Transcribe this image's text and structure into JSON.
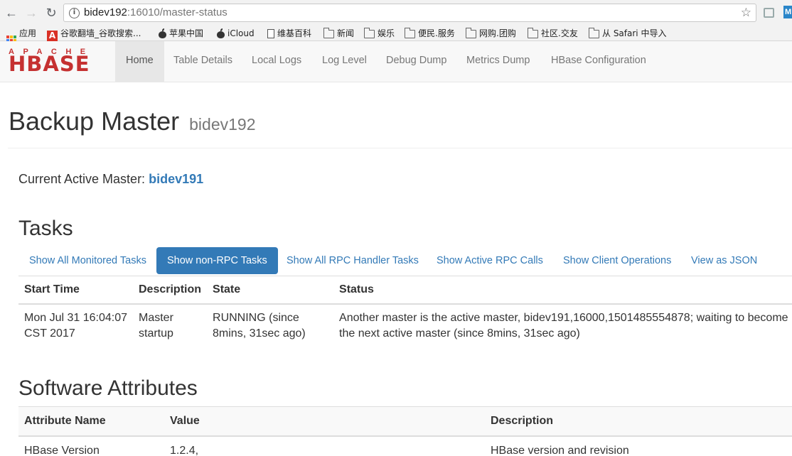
{
  "browser": {
    "url_host": "bidev192",
    "url_rest": ":16010/master-status",
    "bookmarks": [
      {
        "label": "应用",
        "icon": "apps-icon"
      },
      {
        "label": "谷歌翻墙_谷歌搜索...",
        "icon": "red-a-icon"
      },
      {
        "label": "苹果中国",
        "icon": "apple-icon"
      },
      {
        "label": "iCloud",
        "icon": "apple-icon"
      },
      {
        "label": "维基百科",
        "icon": "page-icon"
      },
      {
        "label": "新闻",
        "icon": "folder-icon"
      },
      {
        "label": "娱乐",
        "icon": "folder-icon"
      },
      {
        "label": "便民.服务",
        "icon": "folder-icon"
      },
      {
        "label": "网购.团购",
        "icon": "folder-icon"
      },
      {
        "label": "社区.交友",
        "icon": "folder-icon"
      },
      {
        "label": "从 Safari 中导入",
        "icon": "folder-icon"
      }
    ],
    "ext_label": "M"
  },
  "navbar": {
    "logo_top": "APACHE",
    "logo_main": "HBASE",
    "items": [
      "Home",
      "Table Details",
      "Local Logs",
      "Log Level",
      "Debug Dump",
      "Metrics Dump",
      "HBase Configuration"
    ],
    "active_index": 0
  },
  "header": {
    "title": "Backup Master",
    "host": "bidev192"
  },
  "active_master": {
    "label": "Current Active Master:",
    "host": "bidev191"
  },
  "tasks": {
    "title": "Tasks",
    "pills": [
      "Show All Monitored Tasks",
      "Show non-RPC Tasks",
      "Show All RPC Handler Tasks",
      "Show Active RPC Calls",
      "Show Client Operations",
      "View as JSON"
    ],
    "active_pill": 1,
    "columns": [
      "Start Time",
      "Description",
      "State",
      "Status"
    ],
    "rows": [
      {
        "start_time": "Mon Jul 31 16:04:07 CST 2017",
        "description": "Master startup",
        "state": "RUNNING (since 8mins, 31sec ago)",
        "status": "Another master is the active master, bidev191,16000,1501485554878; waiting to become the next active master (since 8mins, 31sec ago)"
      }
    ]
  },
  "software": {
    "title": "Software Attributes",
    "columns": [
      "Attribute Name",
      "Value",
      "Description"
    ],
    "rows": [
      {
        "name": "HBase Version",
        "value": "1.2.4,",
        "description": "HBase version and revision"
      }
    ]
  },
  "colors": {
    "link": "#337ab7",
    "logo": "#c53131"
  }
}
